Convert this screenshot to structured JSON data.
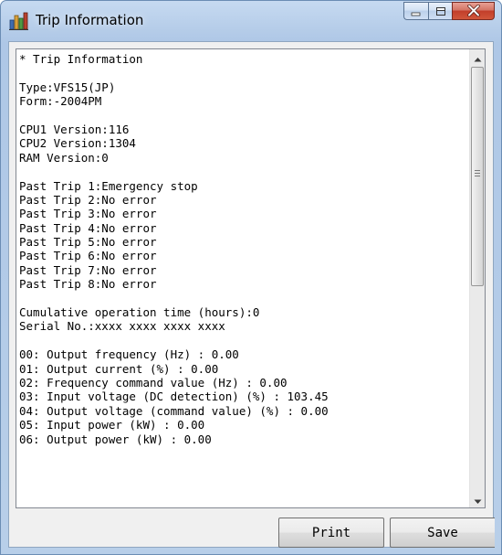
{
  "window": {
    "title": "Trip Information",
    "icons": {
      "app": "chart-app-icon",
      "minimize": "minimize-icon",
      "maximize": "maximize-icon",
      "close": "close-icon",
      "scroll_up": "scroll-up-arrow-icon",
      "scroll_down": "scroll-down-arrow-icon"
    },
    "colors": {
      "frame": "#b6cde9",
      "close_button": "#c23e2a",
      "client_background": "#f0f0f0"
    }
  },
  "text_area": {
    "lines": [
      "* Trip Information",
      "",
      "Type:VFS15(JP)",
      "Form:-2004PM",
      "",
      "CPU1 Version:116",
      "CPU2 Version:1304",
      "RAM Version:0",
      "",
      "Past Trip 1:Emergency stop",
      "Past Trip 2:No error",
      "Past Trip 3:No error",
      "Past Trip 4:No error",
      "Past Trip 5:No error",
      "Past Trip 6:No error",
      "Past Trip 7:No error",
      "Past Trip 8:No error",
      "",
      "Cumulative operation time (hours):0",
      "Serial No.:xxxx xxxx xxxx xxxx",
      "",
      "00: Output frequency (Hz) : 0.00",
      "01: Output current (%) : 0.00",
      "02: Frequency command value (Hz) : 0.00",
      "03: Input voltage (DC detection) (%) : 103.45",
      "04: Output voltage (command value) (%) : 0.00",
      "05: Input power (kW) : 0.00",
      "06: Output power (kW) : 0.00"
    ],
    "scroll_position": 0.0
  },
  "buttons": {
    "print_label": "Print",
    "save_label": "Save"
  }
}
